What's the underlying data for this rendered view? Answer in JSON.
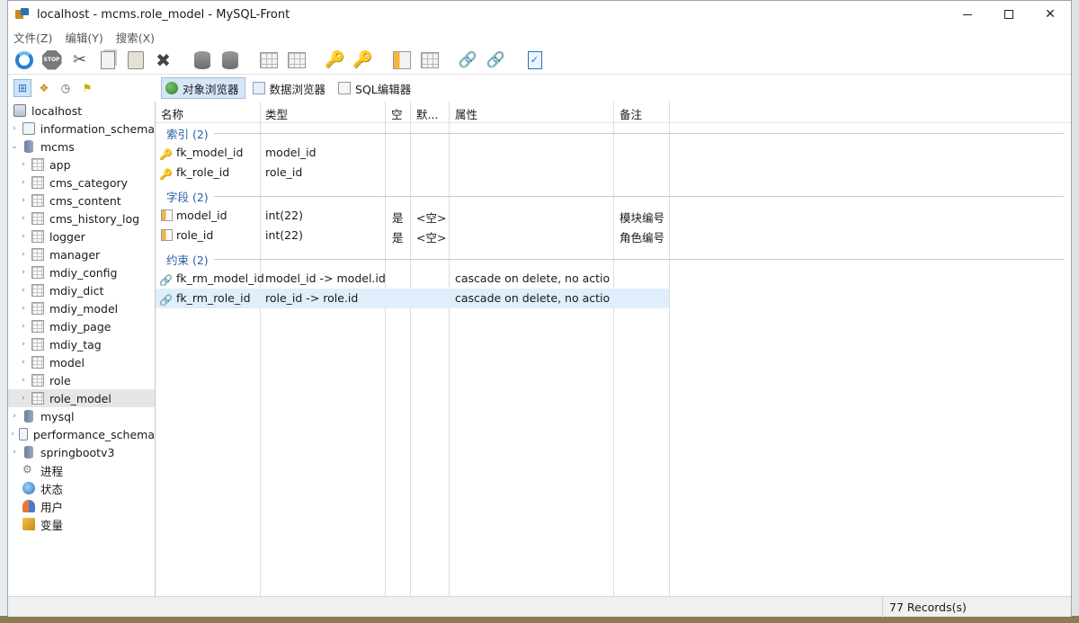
{
  "window": {
    "title": "localhost - mcms.role_model - MySQL-Front",
    "controls": {
      "minimize": "—",
      "maximize": "☐",
      "close": "✕"
    }
  },
  "menu": [
    "文件(Z)",
    "编辑(Y)",
    "搜索(X)"
  ],
  "toolbar": {
    "buttons": [
      "refresh-icon",
      "stop-icon",
      "cut-icon",
      "copy-icon",
      "paste-icon",
      "delete-icon",
      "database-icon",
      "database-delete-icon",
      "table-icon",
      "table-delete-icon",
      "key-add-icon",
      "key-edit-icon",
      "field-add-icon",
      "field-delete-icon",
      "foreign-key-add-icon",
      "foreign-key-edit-icon",
      "checklist-icon"
    ]
  },
  "left_toolbar": [
    "tree-view-icon",
    "hierarchy-icon",
    "history-icon",
    "bookmarks-icon"
  ],
  "tabs": [
    "对象浏览器",
    "数据浏览器",
    "SQL编辑器"
  ],
  "tree": {
    "server": "localhost",
    "databases": [
      {
        "name": "information_schema",
        "kind": "system"
      },
      {
        "name": "mcms",
        "kind": "db",
        "expanded": true,
        "tables": [
          "app",
          "cms_category",
          "cms_content",
          "cms_history_log",
          "logger",
          "manager",
          "mdiy_config",
          "mdiy_dict",
          "mdiy_model",
          "mdiy_page",
          "mdiy_tag",
          "model",
          "role",
          "role_model"
        ],
        "selected": "role_model"
      },
      {
        "name": "mysql",
        "kind": "db"
      },
      {
        "name": "performance_schema",
        "kind": "system"
      },
      {
        "name": "springbootv3",
        "kind": "db"
      }
    ],
    "extras": [
      "进程",
      "状态",
      "用户",
      "变量"
    ]
  },
  "grid": {
    "columns": [
      "名称",
      "类型",
      "空",
      "默...",
      "属性",
      "备注"
    ],
    "groups": [
      {
        "title": "索引 (2)",
        "rows": [
          {
            "icon": "key-icon",
            "name": "fk_model_id",
            "type": "model_id",
            "null": "",
            "default": "",
            "attr": "",
            "comment": ""
          },
          {
            "icon": "key-icon",
            "name": "fk_role_id",
            "type": "role_id",
            "null": "",
            "default": "",
            "attr": "",
            "comment": ""
          }
        ]
      },
      {
        "title": "字段 (2)",
        "rows": [
          {
            "icon": "field-icon",
            "name": "model_id",
            "type": "int(22)",
            "null": "是",
            "default": "<空>",
            "attr": "",
            "comment": "模块编号"
          },
          {
            "icon": "field-icon",
            "name": "role_id",
            "type": "int(22)",
            "null": "是",
            "default": "<空>",
            "attr": "",
            "comment": "角色编号"
          }
        ]
      },
      {
        "title": "约束 (2)",
        "rows": [
          {
            "icon": "link-icon",
            "name": "fk_rm_model_id",
            "type": "model_id -> model.id",
            "null": "",
            "default": "",
            "attr": "cascade on delete, no actio...",
            "comment": ""
          },
          {
            "icon": "link-icon",
            "name": "fk_rm_role_id",
            "type": "role_id -> role.id",
            "null": "",
            "default": "",
            "attr": "cascade on delete, no actio...",
            "comment": "",
            "selected": true
          }
        ]
      }
    ]
  },
  "status": {
    "records": "77 Records(s)"
  }
}
